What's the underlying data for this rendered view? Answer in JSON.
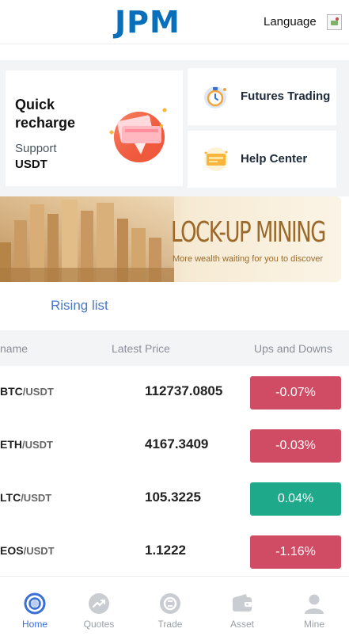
{
  "header": {
    "logo": "JPM",
    "language_label": "Language"
  },
  "features": {
    "recharge": {
      "title": "Quick recharge",
      "subtitle": "Support",
      "coin": "USDT"
    },
    "futures": {
      "label": "Futures Trading"
    },
    "help": {
      "label": "Help Center"
    }
  },
  "banner": {
    "title": "LOCK-UP MINING",
    "subtitle": "More wealth waiting for you to discover"
  },
  "rising": {
    "label": "Rising list"
  },
  "table": {
    "headers": {
      "name": "name",
      "price": "Latest Price",
      "change": "Ups and Downs"
    },
    "rows": [
      {
        "base": "BTC",
        "quote": "/USDT",
        "price": "112737.0805",
        "change": "-0.07%",
        "direction": "down"
      },
      {
        "base": "ETH",
        "quote": "/USDT",
        "price": "4167.3409",
        "change": "-0.03%",
        "direction": "down"
      },
      {
        "base": "LTC",
        "quote": "/USDT",
        "price": "105.3225",
        "change": "0.04%",
        "direction": "up"
      },
      {
        "base": "EOS",
        "quote": "/USDT",
        "price": "1.1222",
        "change": "-1.16%",
        "direction": "down"
      }
    ]
  },
  "colors": {
    "brand": "#0a6fba",
    "down": "#d04c64",
    "up": "#1fa98b",
    "active_nav": "#3a6fd8"
  },
  "nav": {
    "items": [
      {
        "label": "Home",
        "icon": "home-icon",
        "active": true
      },
      {
        "label": "Quotes",
        "icon": "quotes-icon",
        "active": false
      },
      {
        "label": "Trade",
        "icon": "trade-icon",
        "active": false
      },
      {
        "label": "Asset",
        "icon": "wallet-icon",
        "active": false
      },
      {
        "label": "Mine",
        "icon": "user-icon",
        "active": false
      }
    ]
  }
}
